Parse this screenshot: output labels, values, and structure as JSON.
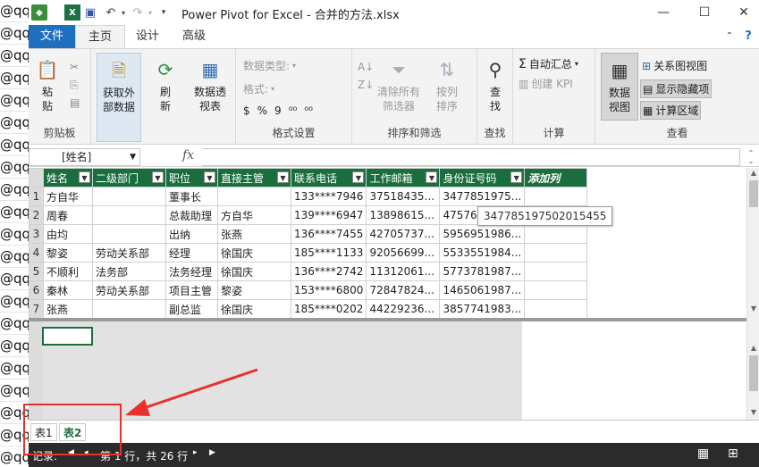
{
  "background_sheet": {
    "row_text": "@qq",
    "row_count": 21
  },
  "window": {
    "title": "Power Pivot for Excel - 合并的方法.xlsx",
    "controls": {
      "minimize": "—",
      "maximize": "☐",
      "close": "✕"
    }
  },
  "tabs": {
    "file": "文件",
    "home": "主页",
    "design": "设计",
    "advanced": "高级"
  },
  "ribbon": {
    "clipboard": {
      "paste": "粘\n贴",
      "label": "剪贴板"
    },
    "get_external": {
      "label": "获取外\n部数据"
    },
    "refresh": {
      "label": "刷\n新"
    },
    "pivot": {
      "label": "数据透\n视表"
    },
    "format": {
      "data_type": "数据类型:",
      "format": "格式:",
      "symbols": {
        "currency": "$",
        "percent": "%",
        "comma": "9",
        "inc": "⁰⁰",
        "dec": "⁰⁰"
      },
      "label": "格式设置"
    },
    "sort_filter": {
      "clear": "清除所有\n筛选器",
      "sort_by": "按列\n排序",
      "label": "排序和筛选"
    },
    "find": {
      "label": "查\n找",
      "group": "查找"
    },
    "calc": {
      "autosum": "自动汇总",
      "kpi": "创建 KPI",
      "label": "计算"
    },
    "view": {
      "data_view": "数据\n视图",
      "diagram": "关系图视图",
      "show_hidden": "显示隐藏项",
      "calc_area": "计算区域",
      "label": "查看"
    }
  },
  "formula_bar": {
    "name_box": "[姓名]",
    "fx": "fx",
    "value": ""
  },
  "table": {
    "columns": [
      "姓名",
      "二级部门",
      "职位",
      "直接主管",
      "联系电话",
      "工作邮箱",
      "身份证号码"
    ],
    "add_column": "添加列",
    "rows": [
      [
        "1",
        "方自华",
        "",
        "董事长",
        "",
        "133****7946",
        "37518435...",
        "3477851975..."
      ],
      [
        "2",
        "周春",
        "",
        "总裁助理",
        "方自华",
        "139****6947",
        "13898615...",
        "475762..."
      ],
      [
        "3",
        "由均",
        "",
        "出纳",
        "张燕",
        "136****7455",
        "42705737...",
        "5956951986..."
      ],
      [
        "4",
        "黎姿",
        "劳动关系部",
        "经理",
        "徐国庆",
        "185****1133",
        "92056699...",
        "5533551984..."
      ],
      [
        "5",
        "不顺利",
        "法务部",
        "法务经理",
        "徐国庆",
        "136****2742",
        "11312061...",
        "5773781987..."
      ],
      [
        "6",
        "秦林",
        "劳动关系部",
        "项目主管",
        "黎姿",
        "153****6800",
        "72847824...",
        "1465061987..."
      ],
      [
        "7",
        "张燕",
        "",
        "副总监",
        "徐国庆",
        "185****0202",
        "44229236...",
        "3857741983..."
      ]
    ]
  },
  "tooltip": "347785197502015455",
  "sheet_tabs": [
    "表1",
    "表2"
  ],
  "status": {
    "record": "记录:",
    "nav_first": "◀",
    "nav_prev": "◂",
    "text": "第 1 行，共 26 行",
    "nav_next": "▸",
    "nav_last": "▶"
  },
  "colors": {
    "accent": "#1f6fbf",
    "table_header": "#1a6e3e",
    "annotation": "#e8312a"
  }
}
